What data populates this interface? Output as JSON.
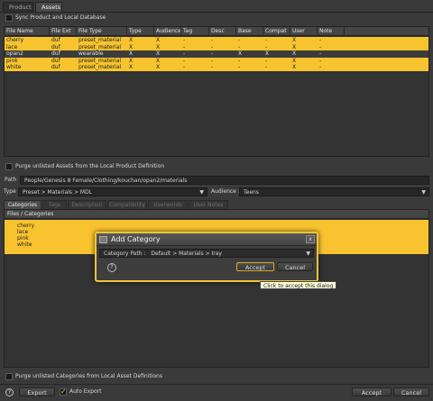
{
  "tabs": [
    "Product",
    "Assets"
  ],
  "sync_label": "Sync Product and Local Database",
  "table": {
    "columns": [
      "File Name",
      "File Ext",
      "File Type",
      "Type",
      "Audience",
      "Tag",
      "Desc",
      "Base",
      "Compat",
      "User",
      "Note"
    ],
    "rows": [
      {
        "cells": [
          "cherry",
          "duf",
          "preset_material",
          "X",
          "X",
          "-",
          "-",
          "-",
          "-",
          "X",
          "-"
        ],
        "selected": true
      },
      {
        "cells": [
          "lace",
          "duf",
          "preset_material",
          "X",
          "X",
          "-",
          "-",
          "-",
          "-",
          "X",
          "-"
        ],
        "selected": true
      },
      {
        "cells": [
          "opan2",
          "duf",
          "wearable",
          "X",
          "X",
          "-",
          "-",
          "X",
          "X",
          "X",
          "-"
        ],
        "selected": false
      },
      {
        "cells": [
          "pink",
          "duf",
          "preset_material",
          "X",
          "X",
          "-",
          "-",
          "-",
          "-",
          "X",
          "-"
        ],
        "selected": true
      },
      {
        "cells": [
          "white",
          "duf",
          "preset_material",
          "X",
          "X",
          "-",
          "-",
          "-",
          "-",
          "X",
          "-"
        ],
        "selected": true
      }
    ]
  },
  "purge_assets_label": "Purge unlisted Assets from the Local Product Definition",
  "path": {
    "label": "Path",
    "value": "People/Genesis 8 Female/Clothing/kouchan/opan2/materials"
  },
  "type": {
    "label": "Type :",
    "value": "Preset > Materials > MDL"
  },
  "audience": {
    "label": "Audience :",
    "value": "Teens"
  },
  "sub_tabs": [
    "Categories",
    "Tags",
    "Description",
    "Compatibility",
    "Userwords",
    "User Notes"
  ],
  "categories": {
    "header": "Files / Categories",
    "items": [
      "cherry",
      "lace",
      "pink",
      "white"
    ]
  },
  "purge_categories_label": "Purge unlisted Categories from Local Asset Definitions",
  "bottom": {
    "help": "?",
    "export": "Export",
    "auto_export": "Auto Export",
    "accept": "Accept",
    "cancel": "Cancel"
  },
  "dialog": {
    "title": "Add Category",
    "close": "x",
    "path_label": "Category Path :",
    "path_value": "Default > Materials > Iray",
    "help": "?",
    "accept": "Accept",
    "cancel": "Cancel",
    "tooltip": "Click to accept this dialog"
  },
  "colors": {
    "accent": "#f7c42f",
    "background": "#3a3a3a"
  }
}
